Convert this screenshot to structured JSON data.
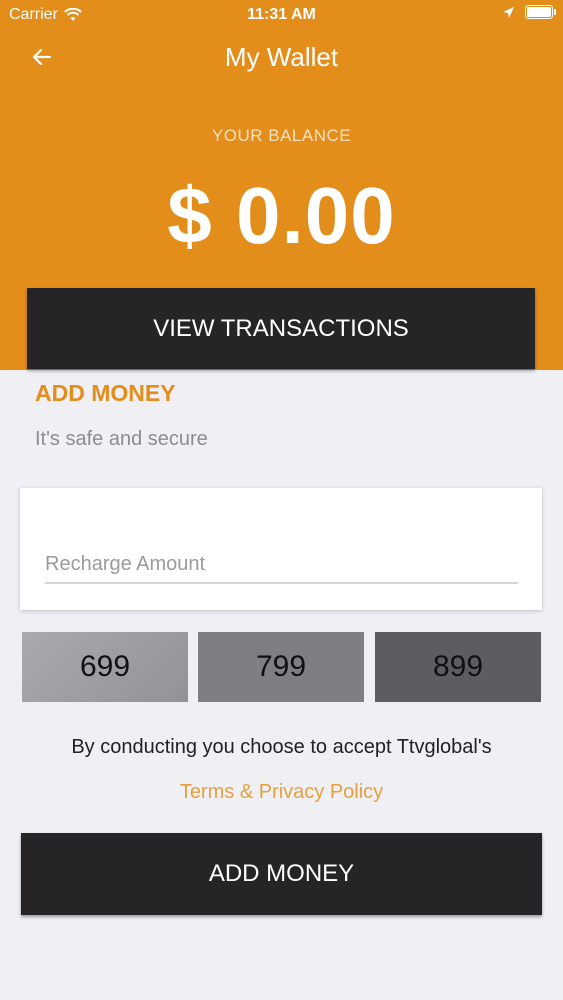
{
  "status_bar": {
    "carrier": "Carrier",
    "time": "11:31 AM",
    "icons": [
      "wifi-icon",
      "location-arrow-icon",
      "battery-icon"
    ]
  },
  "nav": {
    "title": "My Wallet",
    "back_icon": "back-arrow-icon"
  },
  "balance": {
    "label": "YOUR BALANCE",
    "value": "$ 0.00"
  },
  "buttons": {
    "view_transactions": "VIEW TRANSACTIONS",
    "add_money": "ADD MONEY"
  },
  "add_money_section": {
    "heading": "ADD MONEY",
    "subtitle": "It's safe and secure",
    "amount_value": "",
    "amount_placeholder": "Recharge Amount",
    "presets": [
      "699",
      "799",
      "899"
    ]
  },
  "terms": {
    "text": "By conducting you choose to accept Ttvglobal's",
    "link": "Terms & Privacy Policy"
  },
  "colors": {
    "accent": "#e38d1b",
    "dark_button": "#262427",
    "background": "#efeff4",
    "link": "#e7a03f"
  }
}
